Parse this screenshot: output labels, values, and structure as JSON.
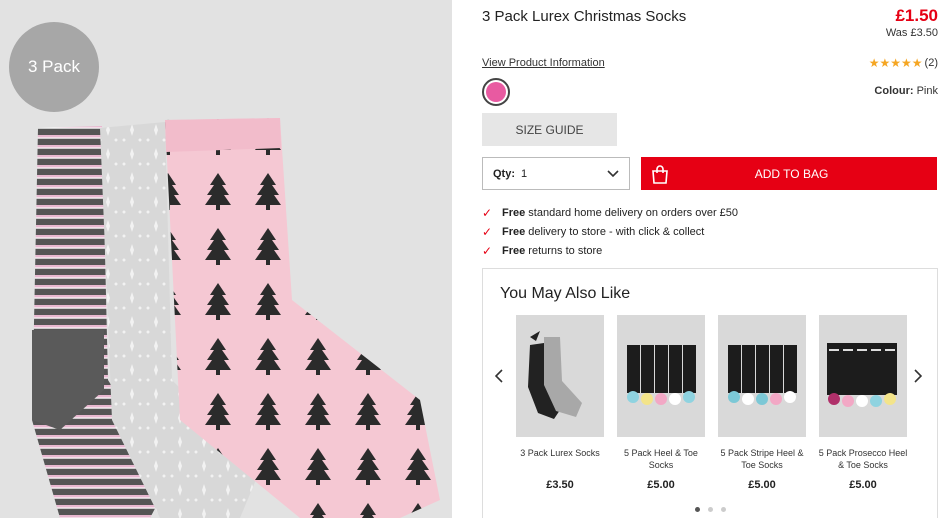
{
  "product": {
    "badge": "3 Pack",
    "title": "3 Pack Lurex Christmas Socks",
    "price": "£1.50",
    "was_price": "Was £3.50",
    "view_info_link": "View Product Information",
    "rating_stars": "★★★★★",
    "rating_count": "(2)",
    "colour_label": "Colour:",
    "colour_value": "Pink",
    "swatch_color": "#e85aa1"
  },
  "actions": {
    "size_guide": "SIZE GUIDE",
    "qty_label": "Qty:",
    "qty_value": "1",
    "add_to_bag": "ADD TO BAG",
    "accent_color": "#e60014"
  },
  "delivery": [
    {
      "bold": "Free",
      "text": " standard home delivery on orders over £50"
    },
    {
      "bold": "Free",
      "text": " delivery to store - with click & collect"
    },
    {
      "bold": "Free",
      "text": " returns to store"
    }
  ],
  "recommendations": {
    "title": "You May Also Like",
    "items": [
      {
        "name": "3 Pack Lurex Socks",
        "price": "£3.50"
      },
      {
        "name": "5 Pack Heel & Toe Socks",
        "price": "£5.00"
      },
      {
        "name": "5 Pack Stripe Heel & Toe Socks",
        "price": "£5.00"
      },
      {
        "name": "5 Pack Prosecco Heel & Toe Socks",
        "price": "£5.00"
      }
    ],
    "page_count": 3,
    "active_page": 1
  }
}
